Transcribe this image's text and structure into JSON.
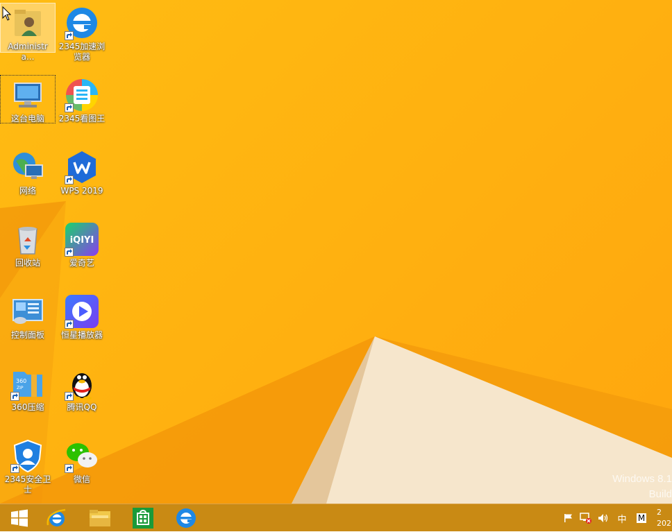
{
  "desktop": {
    "icons": [
      {
        "label": "Administra...",
        "icon": "user-folder-icon"
      },
      {
        "label": "2345加速浏览器",
        "icon": "browser-e-icon"
      },
      {
        "label": "这台电脑",
        "icon": "computer-icon"
      },
      {
        "label": "2345看图王",
        "icon": "image-viewer-icon"
      },
      {
        "label": "网络",
        "icon": "network-icon"
      },
      {
        "label": "WPS 2019",
        "icon": "wps-icon"
      },
      {
        "label": "回收站",
        "icon": "recycle-bin-icon"
      },
      {
        "label": "爱奇艺",
        "icon": "iqiyi-icon"
      },
      {
        "label": "控制面板",
        "icon": "control-panel-icon"
      },
      {
        "label": "恒星播放器",
        "icon": "video-player-icon"
      },
      {
        "label": "360压缩",
        "icon": "zip-archive-icon"
      },
      {
        "label": "腾讯QQ",
        "icon": "qq-penguin-icon"
      },
      {
        "label": "2345安全卫士",
        "icon": "shield-icon"
      },
      {
        "label": "微信",
        "icon": "wechat-icon"
      }
    ],
    "iqiyi_text": "iQIYI",
    "zip_text_top": "360",
    "zip_text_bottom": "ZIP"
  },
  "watermark": {
    "line1": "Windows 8.1",
    "line2": "Build"
  },
  "taskbar": {
    "buttons": [
      "start-button",
      "internet-explorer",
      "file-explorer",
      "store",
      "2345-browser"
    ],
    "tray": {
      "ime": "中",
      "ime_mode": "M"
    },
    "clock": {
      "time": "2",
      "date": "202"
    }
  },
  "colors": {
    "wallpaper": "#ffb310",
    "taskbar": "#c98a14",
    "ie_blue": "#1e88e5"
  }
}
